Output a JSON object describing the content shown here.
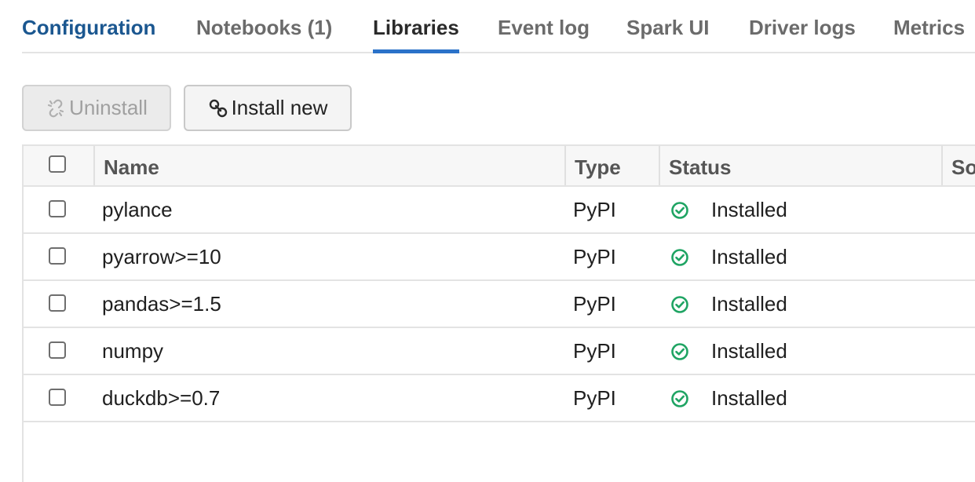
{
  "tabs": [
    {
      "label": "Configuration"
    },
    {
      "label": "Notebooks (1)"
    },
    {
      "label": "Libraries"
    },
    {
      "label": "Event log"
    },
    {
      "label": "Spark UI"
    },
    {
      "label": "Driver logs"
    },
    {
      "label": "Metrics"
    }
  ],
  "selected_tab": "Libraries",
  "toolbar": {
    "uninstall_label": "Uninstall",
    "uninstall_icon": "broken-link-icon",
    "install_label": "Install new",
    "install_icon": "link-icon"
  },
  "table": {
    "columns": [
      "Name",
      "Type",
      "Status",
      "So"
    ],
    "rows": [
      {
        "name": "pylance",
        "type": "PyPI",
        "status": "Installed"
      },
      {
        "name": "pyarrow>=10",
        "type": "PyPI",
        "status": "Installed"
      },
      {
        "name": "pandas>=1.5",
        "type": "PyPI",
        "status": "Installed"
      },
      {
        "name": "numpy",
        "type": "PyPI",
        "status": "Installed"
      },
      {
        "name": "duckdb>=0.7",
        "type": "PyPI",
        "status": "Installed"
      }
    ],
    "status_icon": "check-circle-icon"
  },
  "colors": {
    "accent_blue": "#2b72c9",
    "config_tab_blue": "#1b5790",
    "success_green": "#1fa463"
  }
}
